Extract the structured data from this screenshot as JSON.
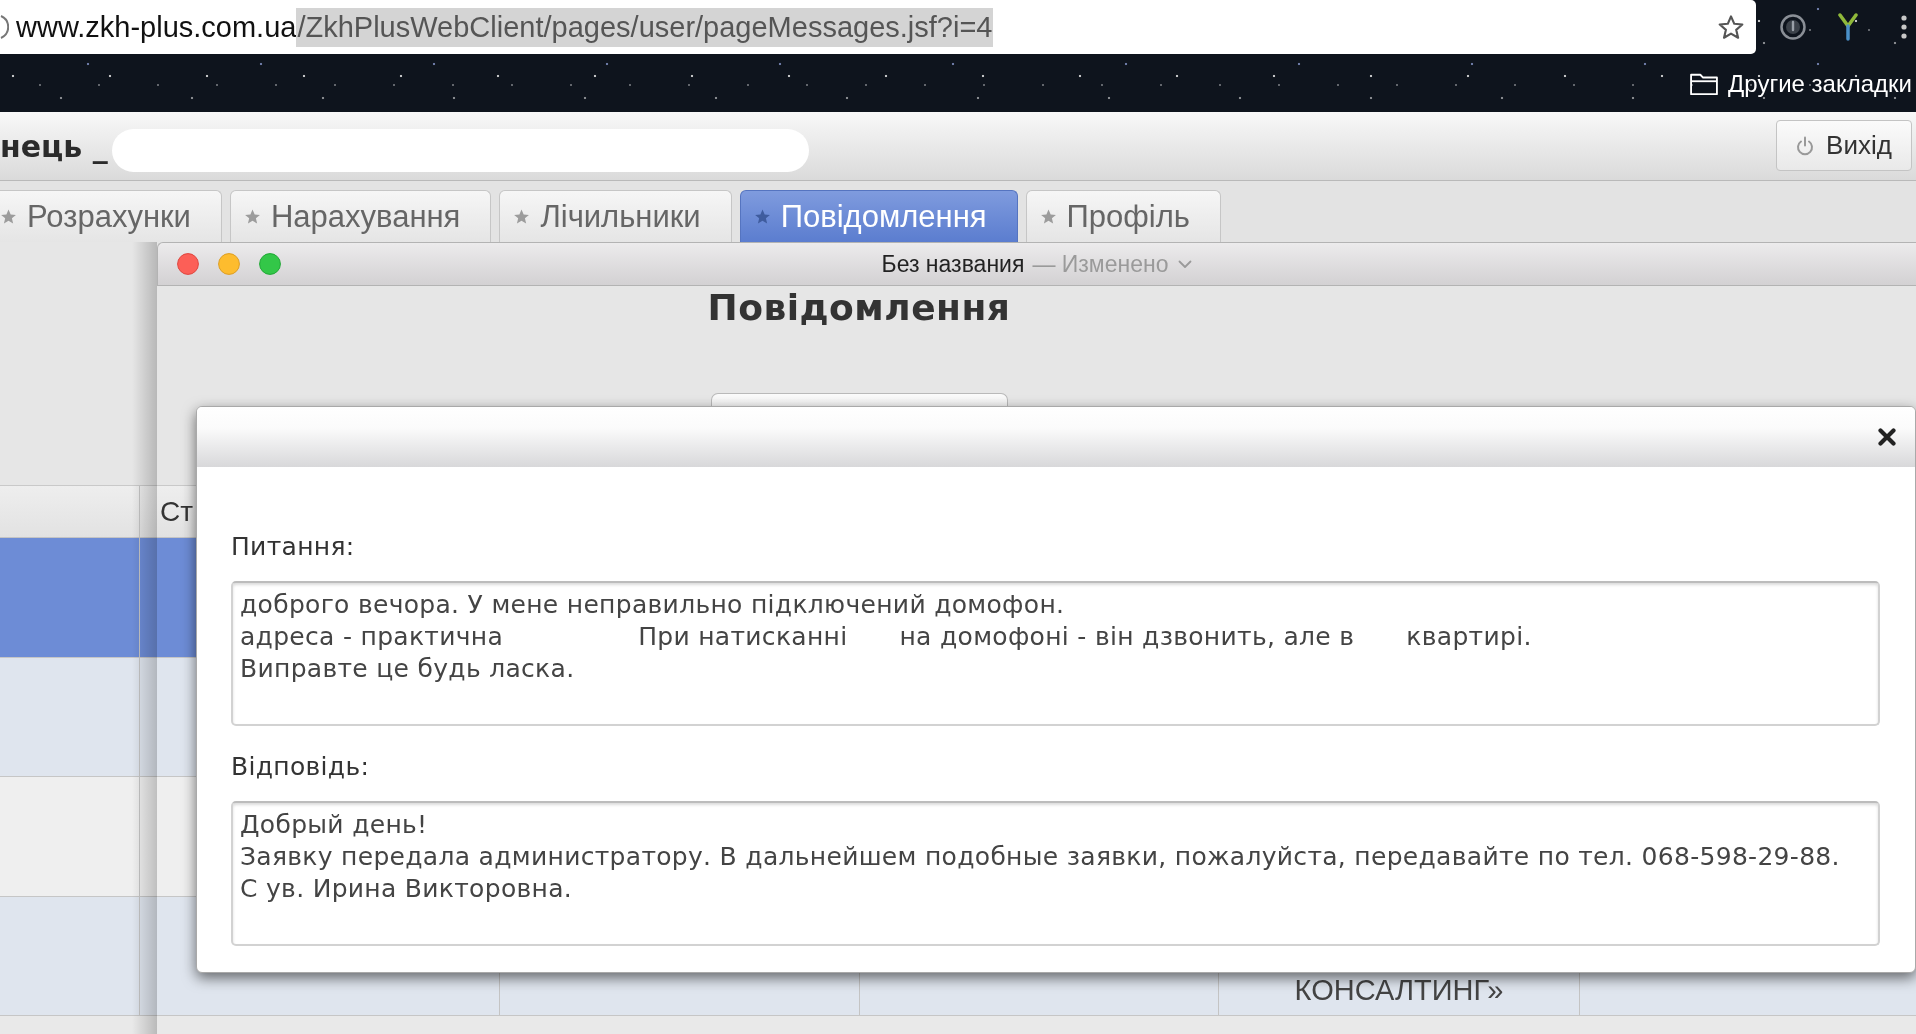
{
  "browser": {
    "address": {
      "host": "www.zkh-plus.com.ua",
      "path": "/ZkhPlusWebClient/pages/user/pageMessages.jsf?i=4",
      "path_selected": true
    },
    "bookmarks": [
      {
        "label": "Другие закладки"
      }
    ]
  },
  "header": {
    "user": "нець _",
    "logout": "Вихід"
  },
  "tabs": [
    {
      "label": "Розрахунки",
      "selected": false
    },
    {
      "label": "Нарахування",
      "selected": false
    },
    {
      "label": "Лічильники",
      "selected": false
    },
    {
      "label": "Повідомлення",
      "selected": true
    },
    {
      "label": "Профіль",
      "selected": false
    }
  ],
  "document_window": {
    "title": "Без названия",
    "separator": "—",
    "status": "Изменено"
  },
  "page": {
    "title": "Повідомлення"
  },
  "table": {
    "header": {
      "column_2": "Ст"
    },
    "rows": [
      {
        "selected": true
      },
      {
        "selected": false
      },
      {
        "selected": false
      },
      {
        "selected": false,
        "column_5": "КОНСАЛТИНГ»"
      }
    ]
  },
  "dialog": {
    "fields": [
      {
        "label": "Питання:",
        "lines": [
          [
            "доброго вечора. У мене неправильно підключений домофон."
          ],
          [
            "адреса - практична",
            "При натисканні",
            "на домофоні - він дзвонить, але в",
            "квартирі."
          ],
          [
            "Виправте це будь ласка."
          ]
        ]
      },
      {
        "label": "Відповідь:",
        "lines": [
          [
            "Добрый день!"
          ],
          [
            "Заявку передала администратору. В дальнейшем подобные заявки, пожалуйста, передавайте по тел. 068-598-29-88."
          ],
          [
            "С ув. Ирина Викторовна."
          ]
        ]
      }
    ]
  }
}
